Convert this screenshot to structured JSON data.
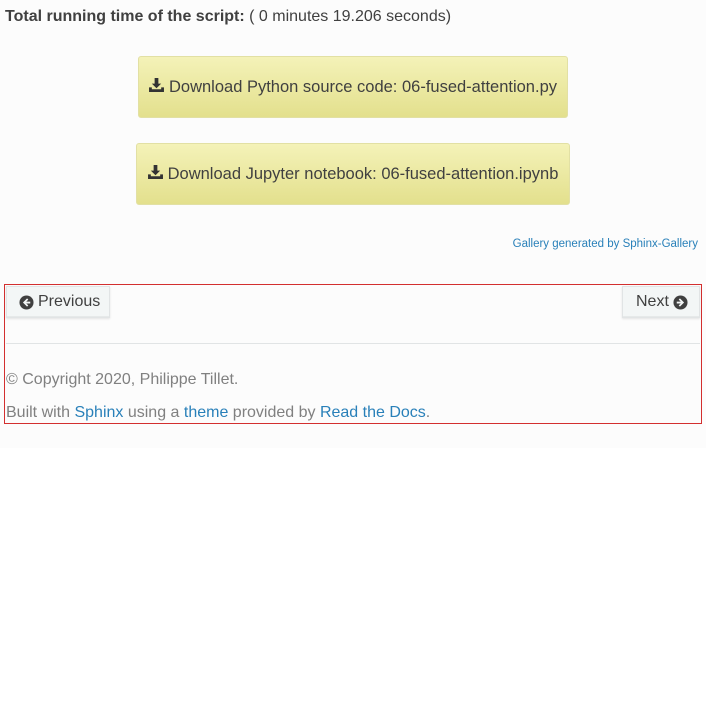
{
  "runtime": {
    "label": "Total running time of the script:",
    "value": " ( 0 minutes 19.206 seconds)"
  },
  "downloads": {
    "python": {
      "label": "Download Python source code: 06-fused-attention.py",
      "icon": "download-icon"
    },
    "notebook": {
      "label": "Download Jupyter notebook: 06-fused-attention.ipynb",
      "icon": "download-icon"
    }
  },
  "gallery_credit": "Gallery generated by Sphinx-Gallery",
  "nav": {
    "previous": {
      "label": "Previous",
      "icon": "arrow-circle-left-icon"
    },
    "next": {
      "label": "Next",
      "icon": "arrow-circle-right-icon"
    }
  },
  "footer": {
    "copyright": "© Copyright 2020, Philippe Tillet.",
    "built_prefix": "Built with ",
    "sphinx": "Sphinx",
    "using_a": " using a ",
    "theme": "theme",
    "provided_by": " provided by ",
    "rtd": "Read the Docs",
    "period": "."
  },
  "colors": {
    "link": "#2980b9",
    "button_yellow": "#e3e08d",
    "footer_border": "#d32f2f",
    "text": "#404040"
  }
}
